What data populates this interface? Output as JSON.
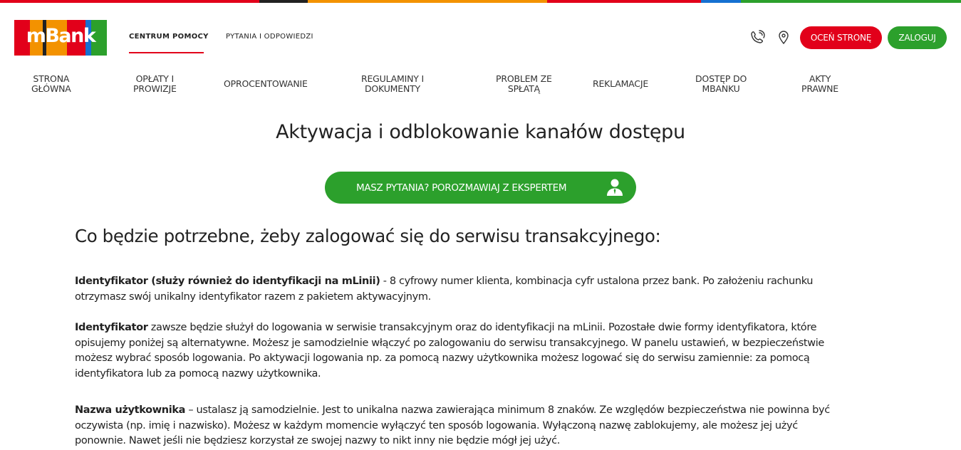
{
  "colors": {
    "brand_red": "#e2001a",
    "brand_green": "#2ca02c",
    "stripe": [
      "#e2001a",
      "#222222",
      "#f39200",
      "#e2001a",
      "#1570d1",
      "#2ca02c"
    ],
    "logo_bars": [
      "#e2001a",
      "#f39200",
      "#222222",
      "#f39200",
      "#e2001a",
      "#1570d1",
      "#2ca02c"
    ]
  },
  "logo": {
    "text": "mBank"
  },
  "topnav": {
    "active": "CENTRUM POMOCY",
    "second": "PYTANIA I ODPOWIEDZI"
  },
  "header_actions": {
    "phone_icon": "phone-icon",
    "location_icon": "location-pin-icon",
    "rate_label": "OCEŃ STRONĘ",
    "login_label": "ZALOGUJ"
  },
  "catnav": [
    {
      "l1": "STRONA",
      "l2": "GŁÓWNA"
    },
    {
      "l1": "OPŁATY I",
      "l2": "PROWIZJE"
    },
    {
      "l1": "OPROCENTOWANIE",
      "l2": ""
    },
    {
      "l1": "REGULAMINY I",
      "l2": "DOKUMENTY"
    },
    {
      "l1": "PROBLEM ZE",
      "l2": "SPŁATĄ"
    },
    {
      "l1": "REKLAMACJE",
      "l2": ""
    },
    {
      "l1": "DOSTĘP DO",
      "l2": "MBANKU"
    },
    {
      "l1": "AKTY",
      "l2": "PRAWNE"
    }
  ],
  "page": {
    "title": "Aktywacja i odblokowanie kanałów dostępu",
    "cta_label": "MASZ PYTANIA? PORozMAWIAJ Z EKSPERTEM",
    "cta_icon": "expert-person-icon",
    "subtitle": "Co będzie potrzebne, żeby zalogować się do serwisu transakcyjnego:"
  },
  "paragraphs": {
    "p1": {
      "bold": "Identyfikator (służy również do identyfikacji na mLinii)",
      "l1": " - 8 cyfrowy numer klienta, kombinacja cyfr ustalona przez bank. Po założeniu rachunku",
      "l2": "otrzymasz swój unikalny identyfikator razem z pakietem aktywacyjnym."
    },
    "p2": {
      "bold": "Identyfikator",
      "l1": " zawsze będzie służył do logowania w serwisie transakcyjnym oraz do identyfikacji na mLinii. Pozostałe dwie formy identyfikatora, które",
      "l2": "opisujemy poniżej są alternatywne. Możesz je samodzielnie włączyć po zalogowaniu do serwisu transakcyjnego.  W panelu ustawień, w bezpieczeństwie",
      "l3": "możesz wybrać sposób logowania. Po aktywacji logowania np. za pomocą nazwy użytkownika możesz logować się do serwisu zamiennie: za pomocą",
      "l4": "identyfikatora lub za pomocą nazwy użytkownika."
    },
    "p3": {
      "bold": "Nazwa użytkownika",
      "l1": " – ustalasz ją samodzielnie. Jest to unikalna nazwa zawierająca minimum 8 znaków. Ze względów bezpieczeństwa nie powinna być",
      "l2": "oczywista (np. imię i nazwisko).  Możesz w każdym momencie wyłączyć ten sposób logowania. Wyłączoną nazwę zablokujemy, ale możesz jej użyć",
      "l3": "ponownie. Nawet jeśli nie będziesz korzystał ze swojej nazwy to nikt inny nie będzie mógł jej użyć."
    }
  }
}
